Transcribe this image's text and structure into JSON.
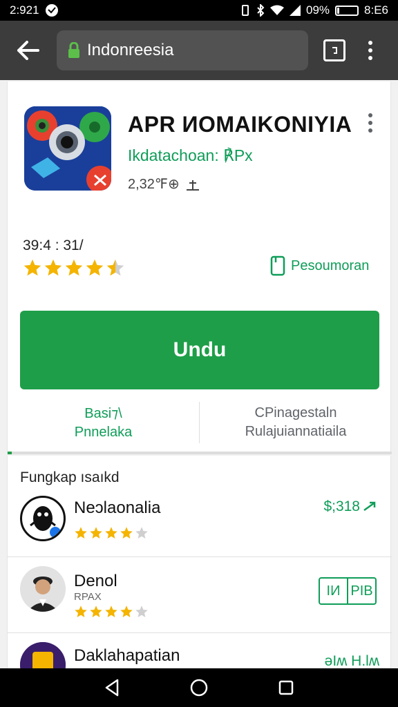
{
  "status_bar": {
    "time_left": "2:921",
    "battery_text": "09%",
    "time_right": "8:E6",
    "battery_level": 0.09
  },
  "browser": {
    "url": "Indonreesia"
  },
  "app": {
    "title": "APR ИOMAIKONIYIA",
    "developer": "Ikdatachoan: ℟Px",
    "meta": "2,32℉⊕",
    "rating_count": "39:4 : 31/",
    "rating_stars": 4.5,
    "wishlist_label": "Pesoumoran",
    "install_label": "Undu",
    "info_left_top": "Basi⁊\\",
    "info_left_bottom": "Pnnelaka",
    "info_right_top": "CPinagestaln",
    "info_right_bottom": "Rulajuiannatiaila"
  },
  "list": {
    "title": "Fungkap ısaıkd",
    "items": [
      {
        "name": "Neɔlaonalia",
        "sub": "",
        "stars": 4,
        "price": "$;318"
      },
      {
        "name": "Denol",
        "sub": "RPAX",
        "stars": 4,
        "badge_left": "IИ",
        "badge_right": "PIB"
      },
      {
        "name": "Daklahapatian",
        "sub": "",
        "stars": 0,
        "price": "ǝIʍ H.lʍ"
      }
    ]
  },
  "colors": {
    "accent": "#1e9e48",
    "accent_text": "#0f9d58",
    "star": "#f4b400",
    "toolbar": "#3c3c3c"
  },
  "icons": [
    "back-arrow-icon",
    "lock-icon",
    "tabs-icon",
    "overflow-menu-icon",
    "star-icon",
    "bookmark-icon",
    "share-icon",
    "nav-back-icon",
    "nav-home-icon",
    "nav-recents-icon"
  ]
}
